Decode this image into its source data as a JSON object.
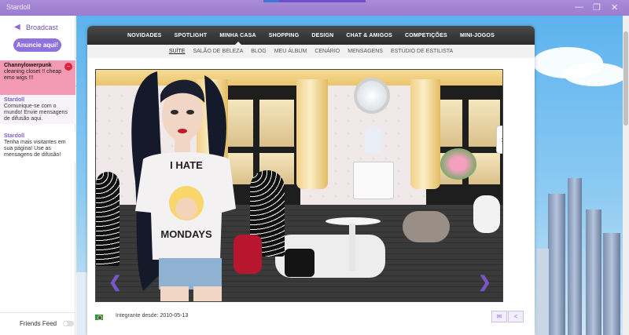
{
  "window": {
    "title": "Stardoll"
  },
  "sidebar": {
    "broadcast_label": "Broadcast",
    "ad_button": "Anuncie aqui!",
    "messages": [
      {
        "user": "Channylowerpunk",
        "text": "cleaning closet !! cheap emo wigs !!!"
      },
      {
        "user": "Stardoll",
        "text": "Comunique-se com o mundo! Envie mensagens de difusão aqui."
      },
      {
        "user": "Stardoll",
        "text": "Tenha mais visitantes em sua página! Use as mensagens de difusão!"
      }
    ],
    "friends_feed": "Friends Feed"
  },
  "topnav": [
    "NOVIDADES",
    "SPOTLIGHT",
    "MINHA CASA",
    "SHOPPING",
    "DESIGN",
    "CHAT & AMIGOS",
    "COMPETIÇÕES",
    "MINI-JOGOS"
  ],
  "subnav": [
    "SUÍTE",
    "SALÃO DE BELEZA",
    "BLOG",
    "MEU ÁLBUM",
    "CENÁRIO",
    "MENSAGENS",
    "ESTÚDIO DE ESTILISTA"
  ],
  "room": {
    "shirt_line1": "I HATE",
    "shirt_line2": "MONDAYS"
  },
  "footer": {
    "member_label": "Integrante desde:",
    "member_date": "2010-05-13"
  },
  "colors": {
    "accent": "#8f72dd",
    "nav_bg": "#2f2f2f",
    "alert": "#f39bb5"
  }
}
